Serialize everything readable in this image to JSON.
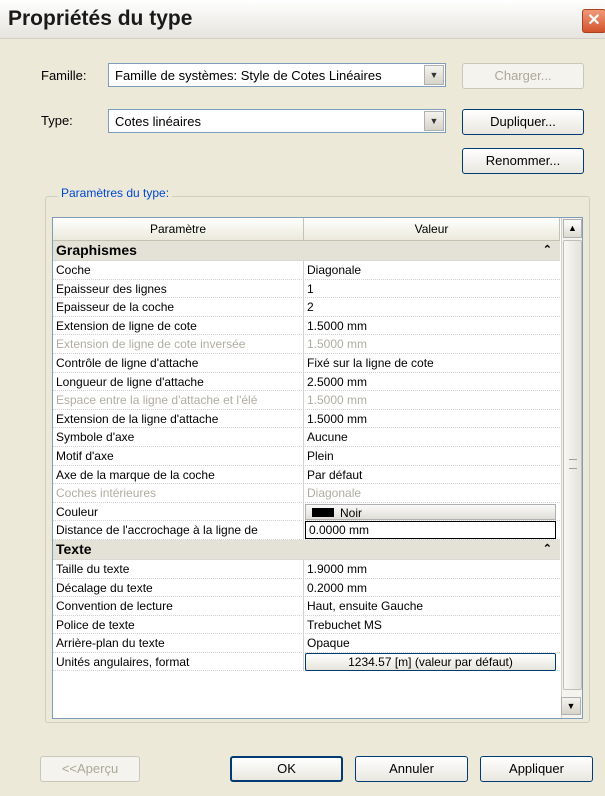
{
  "window": {
    "title": "Propriétés du type"
  },
  "family": {
    "label": "Famille:",
    "value": "Famille de systèmes: Style de Cotes Linéaires",
    "load_button": "Charger..."
  },
  "type": {
    "label": "Type:",
    "value": "Cotes linéaires",
    "duplicate_button": "Dupliquer...",
    "rename_button": "Renommer..."
  },
  "params": {
    "group_title": "Paramètres du type:",
    "header_param": "Paramètre",
    "header_value": "Valeur",
    "groups": [
      {
        "name": "Graphismes"
      },
      {
        "name": "Texte"
      }
    ],
    "graphics_rows": [
      {
        "param": "Coche",
        "value": "Diagonale"
      },
      {
        "param": "Epaisseur des lignes",
        "value": "1"
      },
      {
        "param": "Epaisseur de la coche",
        "value": "2"
      },
      {
        "param": "Extension de ligne de cote",
        "value": "1.5000 mm"
      },
      {
        "param": "Extension de ligne de cote inversée",
        "value": "1.5000 mm"
      },
      {
        "param": "Contrôle de ligne d'attache",
        "value": "Fixé sur la ligne de cote"
      },
      {
        "param": "Longueur de ligne d'attache",
        "value": "2.5000 mm"
      },
      {
        "param": "Espace entre la ligne d'attache et l'élé",
        "value": "1.5000 mm"
      },
      {
        "param": "Extension de la ligne d'attache",
        "value": "1.5000 mm"
      },
      {
        "param": "Symbole d'axe",
        "value": "Aucune"
      },
      {
        "param": "Motif d'axe",
        "value": "Plein"
      },
      {
        "param": "Axe de la marque de la coche",
        "value": "Par défaut"
      },
      {
        "param": "Coches intérieures",
        "value": "Diagonale"
      },
      {
        "param": "Couleur",
        "value": "Noir"
      },
      {
        "param": "Distance de l'accrochage à la ligne de",
        "value": "0.0000 mm"
      }
    ],
    "text_rows": [
      {
        "param": "Taille du texte",
        "value": "1.9000 mm"
      },
      {
        "param": "Décalage du texte",
        "value": "0.2000 mm"
      },
      {
        "param": "Convention de lecture",
        "value": "Haut, ensuite Gauche"
      },
      {
        "param": "Police de texte",
        "value": "Trebuchet MS"
      },
      {
        "param": "Arrière-plan du texte",
        "value": "Opaque"
      },
      {
        "param": "Unités angulaires, format",
        "value": "1234.57 [m] (valeur par défaut)"
      }
    ]
  },
  "footer": {
    "preview_button": "<<Aperçu",
    "ok_button": "OK",
    "cancel_button": "Annuler",
    "apply_button": "Appliquer"
  }
}
